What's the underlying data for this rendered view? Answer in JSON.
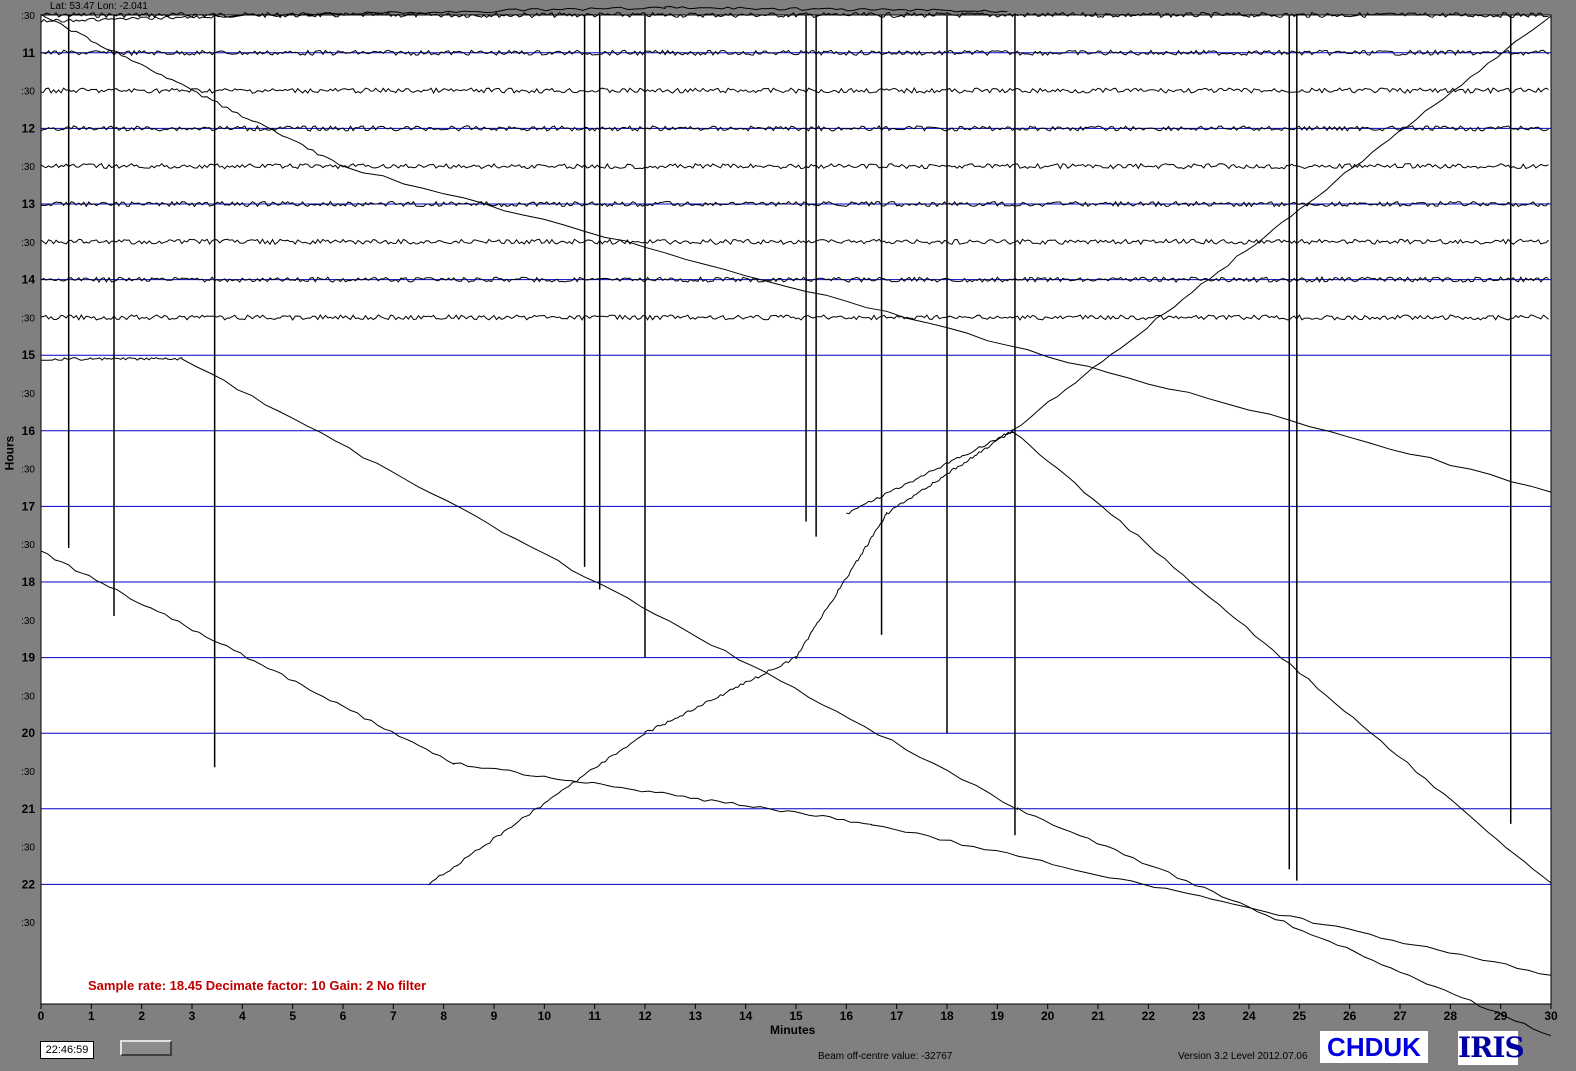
{
  "header": {
    "coords": "Lat: 53.47 Lon: -2.041"
  },
  "status": {
    "time": "22:46:59",
    "beam": "Beam off-centre value: -32767",
    "version": "Version 3.2 Level 2012.07.06"
  },
  "station": "CHDUK",
  "logo": "IRIS",
  "info": "Sample rate: 18.45  Decimate factor: 10  Gain: 2  No filter",
  "colors": {
    "background": "#808080",
    "plot": "#ffffff",
    "grid": "#0000c8",
    "trace": "#000000",
    "info": "#c00000"
  },
  "chart_data": {
    "type": "line",
    "title": "",
    "xlabel": "Minutes",
    "ylabel": "Hours",
    "xlim": [
      0,
      30
    ],
    "x_ticks": [
      "0",
      "1",
      "2",
      "3",
      "4",
      "5",
      "6",
      "7",
      "8",
      "9",
      "10",
      "11",
      "12",
      "13",
      "14",
      "15",
      "16",
      "17",
      "18",
      "19",
      "20",
      "21",
      "22",
      "23",
      "24",
      "25",
      "26",
      "27",
      "28",
      "29",
      "30"
    ],
    "y_ticks": [
      ":30",
      "11",
      ":30",
      "12",
      ":30",
      "13",
      ":30",
      "14",
      ":30",
      "15",
      ":30",
      "16",
      ":30",
      "17",
      ":30",
      "18",
      ":30",
      "19",
      ":30",
      "20",
      ":30",
      "21",
      ":30",
      "22",
      ":30"
    ],
    "grid": true,
    "series": [
      {
        "hour": 10.5,
        "type": "flat"
      },
      {
        "hour": 11.0,
        "type": "flat"
      },
      {
        "hour": 11.5,
        "type": "flat"
      },
      {
        "hour": 12.0,
        "type": "flat"
      },
      {
        "hour": 12.5,
        "type": "flat"
      },
      {
        "hour": 13.0,
        "type": "flat"
      },
      {
        "hour": 13.5,
        "type": "flat"
      },
      {
        "hour": 14.0,
        "type": "flat"
      },
      {
        "hour": 14.5,
        "type": "flat"
      },
      {
        "x": [
          0,
          3.5,
          12.4,
          19.2
        ],
        "y": [
          10.58,
          10.52,
          10.4,
          10.45
        ],
        "type": "drift"
      },
      {
        "x": [
          0,
          2.8,
          19.4,
          30
        ],
        "y": [
          15.05,
          15.05,
          21.0,
          24.0
        ],
        "type": "drift"
      },
      {
        "x": [
          0,
          6,
          30
        ],
        "y": [
          10.5,
          12.5,
          16.8
        ],
        "type": "drift"
      },
      {
        "x": [
          0,
          8.2,
          16.5,
          30
        ],
        "y": [
          17.6,
          20.4,
          21.2,
          23.2
        ],
        "type": "drift"
      },
      {
        "x": [
          7.7,
          12.0,
          15.0,
          16.8,
          19.3,
          30
        ],
        "y": [
          22.0,
          20.0,
          19.0,
          17.1,
          16.0,
          10.5
        ],
        "type": "drift"
      },
      {
        "x": [
          16.0,
          19.3,
          30
        ],
        "y": [
          17.1,
          16.0,
          22.0
        ],
        "type": "drift"
      }
    ]
  }
}
